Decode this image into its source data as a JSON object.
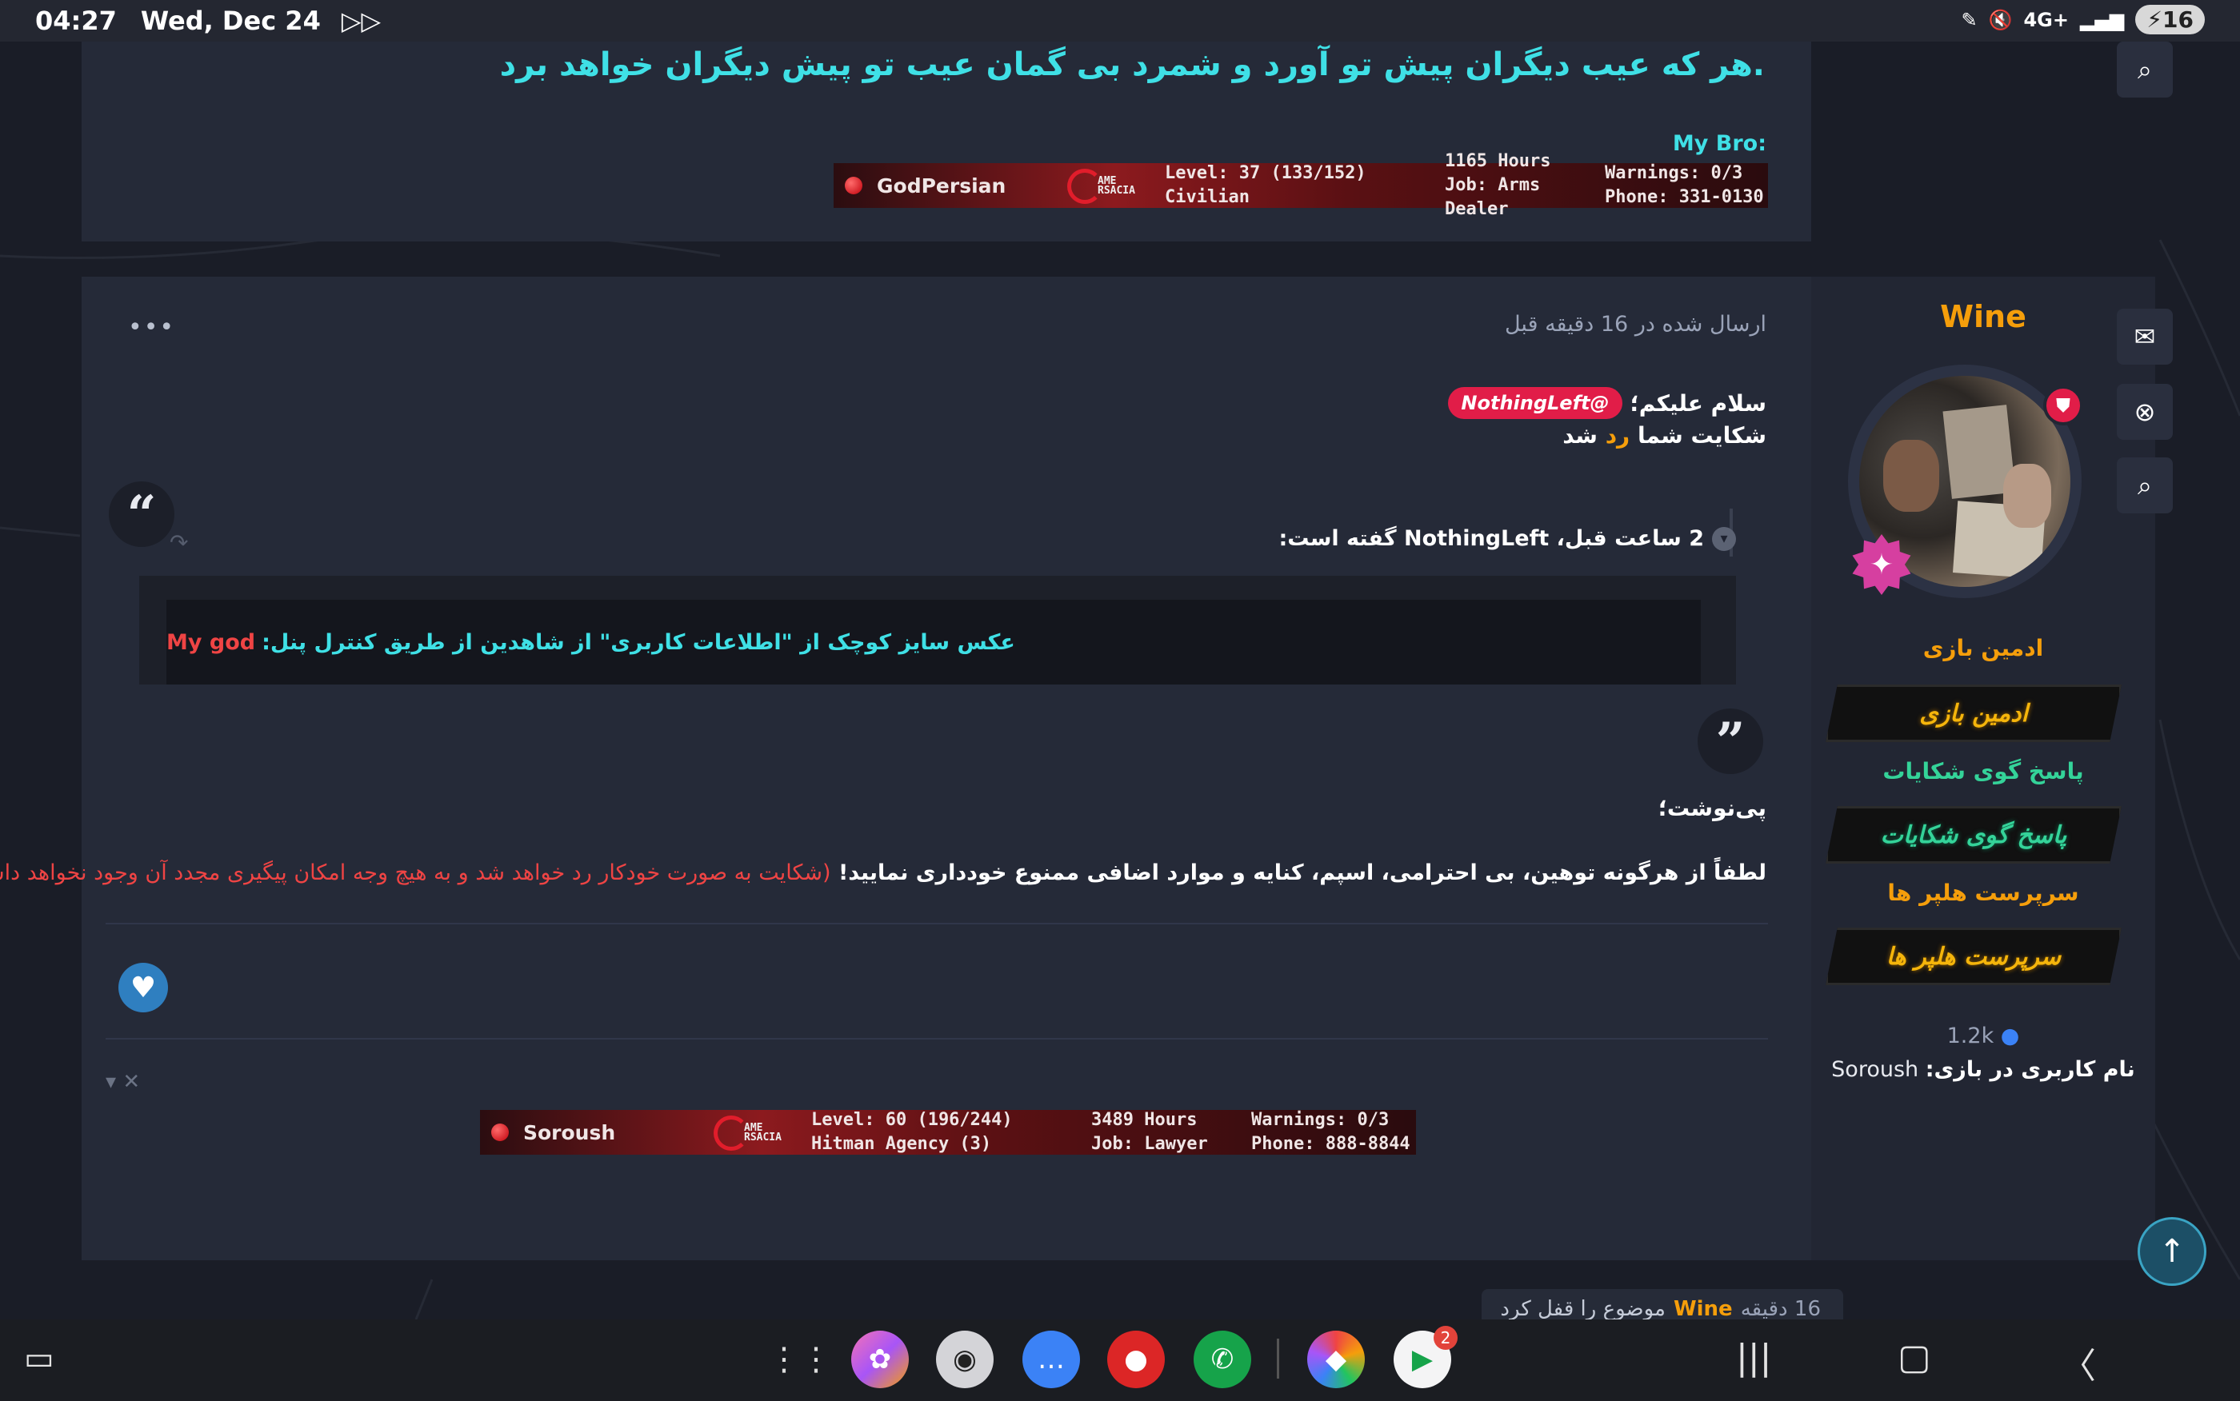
{
  "statusbar": {
    "time": "04:27",
    "date": "Wed, Dec 24",
    "battery": "16",
    "network": "4G+"
  },
  "top_post": {
    "signature_text": "هر که عیب دیگران پیش تو آورد و شمرد بی گمان عیب تو پیش دیگران خواهد برد.",
    "mybro_label": "My Bro:",
    "banner": {
      "player_name": "GodPersian",
      "logo_text": "AME RSACIA",
      "level": "Level: 37 (133/152)",
      "job_role": "Civilian",
      "hours": "1165 Hours",
      "job": "Job: Arms Dealer",
      "warnings": "Warnings: 0/3",
      "phone": "Phone: 331-0130"
    }
  },
  "post": {
    "date": "ارسال شده در 16 دقیقه قبل",
    "menu_icon": "•••",
    "greeting": "سلام علیکم؛",
    "mention": "@NothingLeft",
    "line2_prefix": "شکایت شما",
    "line2_status": "رد",
    "line2_suffix": "شد",
    "quote": {
      "header": "2 ساعت قبل، NothingLeft گفته است:",
      "text_cyan": "عکس سایز کوچک از \"اطلاعات کاربری\" از شاهدین از طریق کنترل پنل:",
      "text_red": "My god"
    },
    "ps": "پی‌نوشت؛",
    "rules_white": "لطفاً از هرگونه توهین، بی احترامی، اسپم، کنایه و موارد اضافی ممنوع خودداری نمایید!",
    "rules_red": "(شکایت به صورت خودکار رد خواهد شد و به هیچ وجه امکان پیگیری مجدد آن وجود نخواهد داشت)",
    "sig_toggle": "▾ ✕",
    "banner": {
      "player_name": "Soroush",
      "logo_text": "AME RSACIA",
      "level": "Level: 60 (196/244)",
      "job_role": "Hitman Agency (3)",
      "hours": "3489 Hours",
      "job": "Job: Lawyer",
      "warnings": "Warnings: 0/3",
      "phone": "Phone: 888-8844"
    }
  },
  "author": {
    "username": "Wine",
    "role1": "ادمین بازی",
    "role1_banner": "ادمین بازی",
    "role2": "پاسخ گوی شکایات",
    "role2_banner": "پاسخ گوی شکایات",
    "role3": "سرپرست هلپر ها",
    "role3_banner": "سرپرست هلپر ها",
    "messages": "1.2k",
    "ingame_label": "نام کاربری در بازی:",
    "ingame_name": "Soroush"
  },
  "lock_notice": {
    "ago": "16 دقیقه",
    "user": "Wine",
    "action": "موضوع را قفل کرد"
  },
  "colors": {
    "accent_cyan": "#3fe0e6",
    "accent_orange": "#f59e0b",
    "accent_red": "#e11d48",
    "panel": "#252a38"
  }
}
